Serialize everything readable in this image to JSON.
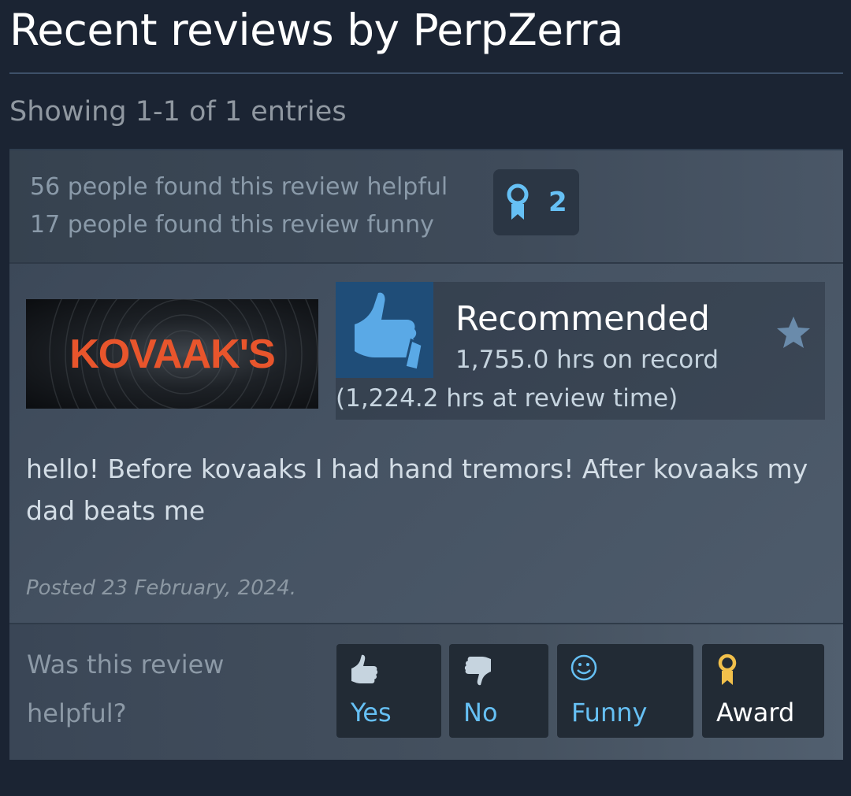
{
  "header": {
    "title": "Recent reviews by PerpZerra",
    "showing": "Showing 1-1 of 1 entries"
  },
  "review": {
    "stats": {
      "helpful": "56 people found this review helpful",
      "funny": "17 people found this review funny",
      "award_count": "2",
      "award_icon": "award-ribbon-icon"
    },
    "game": {
      "logo_text": "KOVAAK'S"
    },
    "verdict": {
      "label": "Recommended",
      "hours_on_record": "1,755.0 hrs on record",
      "hours_at_review": "(1,224.2 hrs at review time)"
    },
    "body": "hello! Before kovaaks I had hand tremors! After kovaaks my dad beats me",
    "posted": "Posted 23 February, 2024."
  },
  "vote": {
    "question": "Was this review helpful?",
    "buttons": {
      "yes": "Yes",
      "no": "No",
      "funny": "Funny",
      "award": "Award"
    }
  },
  "colors": {
    "background": "#1b2433",
    "accent": "#66c0f4",
    "thumb_box": "#1f4d78",
    "award_gold": "#f2c04b",
    "logo_orange": "#e8552c"
  }
}
